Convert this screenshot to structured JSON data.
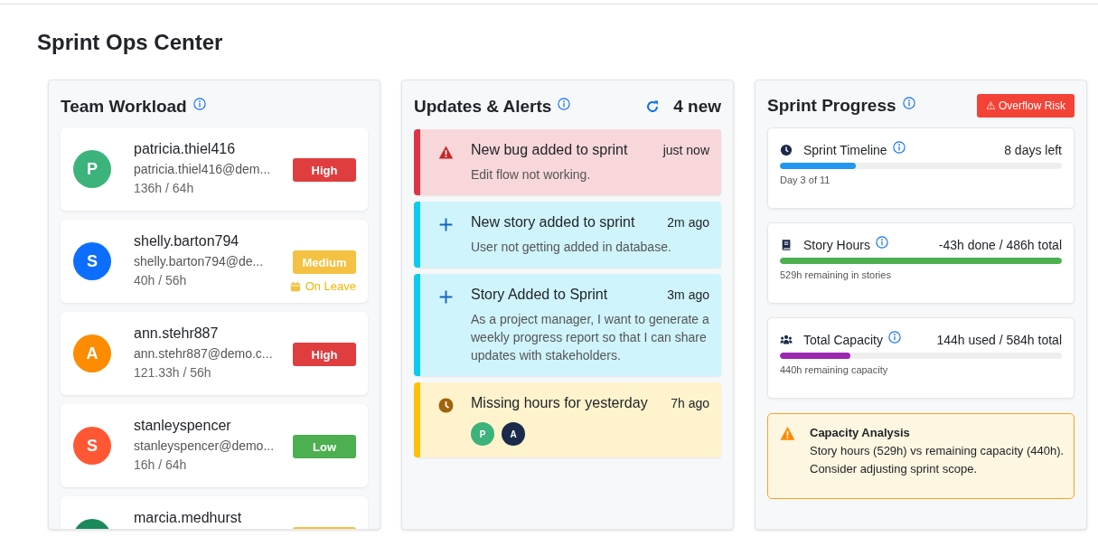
{
  "page_title": "Sprint Ops Center",
  "team_workload": {
    "title": "Team Workload",
    "members": [
      {
        "initial": "P",
        "color": "#3cb37a",
        "name": "patricia.thiel416",
        "email": "patricia.thiel416@dem...",
        "hours": "136h / 64h",
        "badge": {
          "label": "High",
          "color": "#e03e3e"
        },
        "on_leave": false
      },
      {
        "initial": "S",
        "color": "#0d6efd",
        "name": "shelly.barton794",
        "email": "shelly.barton794@de...",
        "hours": "40h / 56h",
        "badge": {
          "label": "Medium",
          "color": "#f4c142"
        },
        "on_leave": true,
        "leave_label": "On Leave"
      },
      {
        "initial": "A",
        "color": "#fd8c00",
        "name": "ann.stehr887",
        "email": "ann.stehr887@demo.c...",
        "hours": "121.33h / 56h",
        "badge": {
          "label": "High",
          "color": "#e03e3e"
        },
        "on_leave": false
      },
      {
        "initial": "S",
        "color": "#ff5733",
        "name": "stanleyspencer",
        "email": "stanleyspencer@demo...",
        "hours": "16h / 64h",
        "badge": {
          "label": "Low",
          "color": "#4caf50"
        },
        "on_leave": false
      },
      {
        "color": "#1a8a5a",
        "name": "marcia.medhurst",
        "badge": {
          "color": "#f4c142"
        }
      }
    ]
  },
  "updates": {
    "title": "Updates & Alerts",
    "new_count": "4 new",
    "alerts": [
      {
        "kind": "bug",
        "title": "New bug added to sprint",
        "time": "just now",
        "body": "Edit flow not working."
      },
      {
        "kind": "story",
        "title": "New story added to sprint",
        "time": "2m ago",
        "body": "User not getting added in database."
      },
      {
        "kind": "story",
        "title": "Story Added to Sprint",
        "time": "3m ago",
        "body": "As a project manager, I want to generate a weekly progress report so that I can share updates with stakeholders."
      },
      {
        "kind": "hours",
        "title": "Missing hours for yesterday",
        "time": "7h ago",
        "avatars": [
          {
            "initial": "P",
            "color": "#3cb37a"
          },
          {
            "initial": "A",
            "color": "#1b2a4a"
          }
        ]
      }
    ]
  },
  "sprint_progress": {
    "title": "Sprint Progress",
    "risk_badge": "⚠ Overflow Risk",
    "metrics": [
      {
        "kind": "timeline",
        "title": "Sprint Timeline",
        "value": "8 days left",
        "level": 0.27,
        "color": "#2196f3",
        "note": "Day 3 of 11"
      },
      {
        "kind": "story_hours",
        "title": "Story Hours",
        "value": "-43h done / 486h total",
        "level": 1,
        "color": "#4caf50",
        "note": "529h remaining in stories"
      },
      {
        "kind": "capacity",
        "title": "Total Capacity",
        "value": "144h used / 584h total",
        "level": 0.25,
        "color": "#9c27b0",
        "note": "440h remaining capacity"
      }
    ],
    "analysis": {
      "title": "Capacity Analysis",
      "text": "Story hours (529h) vs remaining capacity (440h). Consider adjusting sprint scope."
    }
  }
}
